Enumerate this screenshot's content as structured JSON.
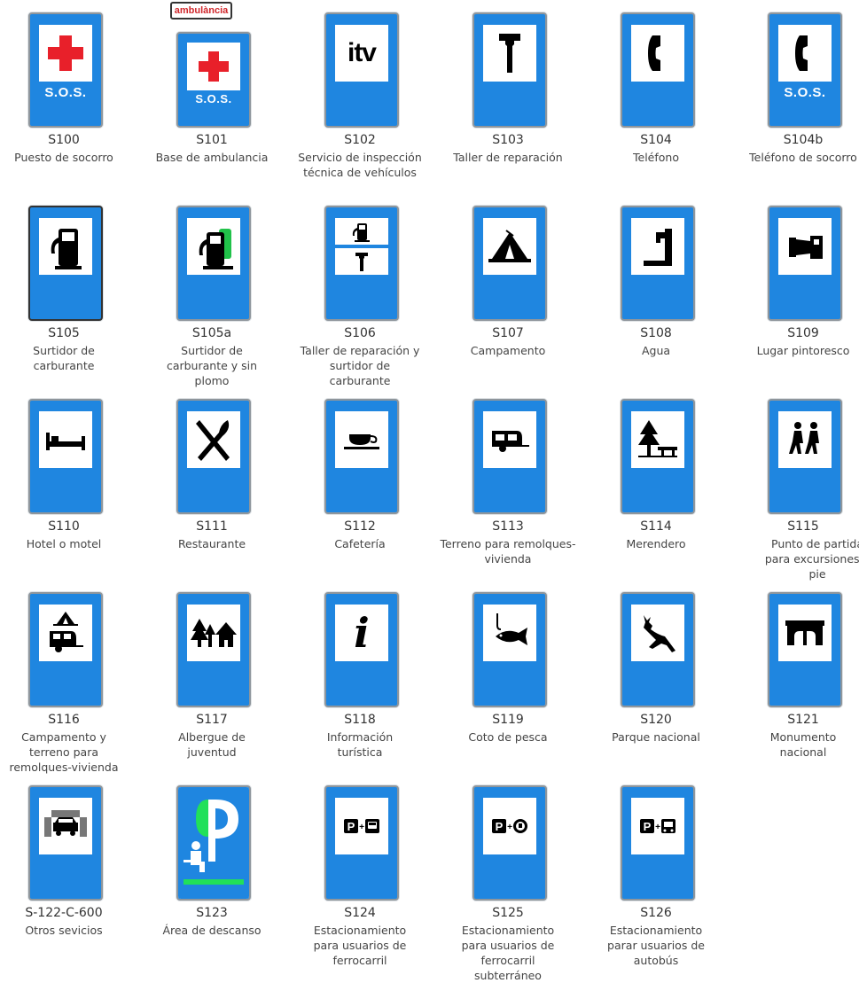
{
  "signs": [
    {
      "code": "S100",
      "label": "Puesto de socorro",
      "icon": "red-cross-icon",
      "sos": "S.O.S."
    },
    {
      "code": "S101",
      "label": "Base de ambulancia",
      "icon": "red-cross-icon",
      "sos": "S.O.S.",
      "tag": "ambulància"
    },
    {
      "code": "S102",
      "label": "Servicio de inspección técnica de vehículos",
      "icon": "itv-icon",
      "icon_text": "itv"
    },
    {
      "code": "S103",
      "label": "Taller de reparación",
      "icon": "wrench-icon"
    },
    {
      "code": "S104",
      "label": "Teléfono",
      "icon": "telephone-icon"
    },
    {
      "code": "S104b",
      "label": "Teléfono de socorro",
      "icon": "telephone-icon",
      "sos": "S.O.S."
    },
    {
      "code": "S105",
      "label": "Surtidor de carburante",
      "icon": "fuel-pump-icon"
    },
    {
      "code": "S105a",
      "label": "Surtidor de carburante y sin plomo",
      "icon": "fuel-pump-unleaded-icon"
    },
    {
      "code": "S106",
      "label": "Taller de reparación y surtidor de carburante",
      "icon": "fuel-and-wrench-icon"
    },
    {
      "code": "S107",
      "label": "Campamento",
      "icon": "tent-icon"
    },
    {
      "code": "S108",
      "label": "Agua",
      "icon": "water-tap-icon"
    },
    {
      "code": "S109",
      "label": "Lugar pintoresco",
      "icon": "camera-icon"
    },
    {
      "code": "S110",
      "label": "Hotel o motel",
      "icon": "bed-icon"
    },
    {
      "code": "S111",
      "label": "Restaurante",
      "icon": "fork-knife-icon"
    },
    {
      "code": "S112",
      "label": "Cafetería",
      "icon": "coffee-cup-icon"
    },
    {
      "code": "S113",
      "label": "Terreno para remolques-vivienda",
      "icon": "caravan-icon"
    },
    {
      "code": "S114",
      "label": "Merendero",
      "icon": "picnic-icon"
    },
    {
      "code": "S115",
      "label": "Punto de partida para excursiones a pie",
      "icon": "hikers-icon"
    },
    {
      "code": "S116",
      "label": "Campamento y terreno para remolques-vivienda",
      "icon": "tent-caravan-icon"
    },
    {
      "code": "S117",
      "label": "Albergue de juventud",
      "icon": "hostel-icon"
    },
    {
      "code": "S118",
      "label": "Información turística",
      "icon": "info-icon",
      "icon_text": "i"
    },
    {
      "code": "S119",
      "label": "Coto de pesca",
      "icon": "fish-icon"
    },
    {
      "code": "S120",
      "label": "Parque nacional",
      "icon": "deer-icon"
    },
    {
      "code": "S121",
      "label": "Monumento nacional",
      "icon": "monument-icon"
    },
    {
      "code": "S-122-C-600",
      "label": "Otros sevicios",
      "icon": "car-service-icon"
    },
    {
      "code": "S123",
      "label": "Área de descanso",
      "icon": "rest-area-icon",
      "icon_text": "P"
    },
    {
      "code": "S124",
      "label": "Estacionamiento para usuarios de ferrocarril",
      "icon": "park-train-icon",
      "icon_text": "P"
    },
    {
      "code": "S125",
      "label": "Estacionamiento para usuarios de ferrocarril subterráneo",
      "icon": "park-metro-icon",
      "icon_text": "P"
    },
    {
      "code": "S126",
      "label": "Estacionamiento parar usuarios de autobús",
      "icon": "park-bus-icon",
      "icon_text": "P"
    }
  ],
  "colors": {
    "sign_blue": "#1f86e0",
    "cross_red": "#e8202a",
    "rest_green": "#21e05a"
  }
}
